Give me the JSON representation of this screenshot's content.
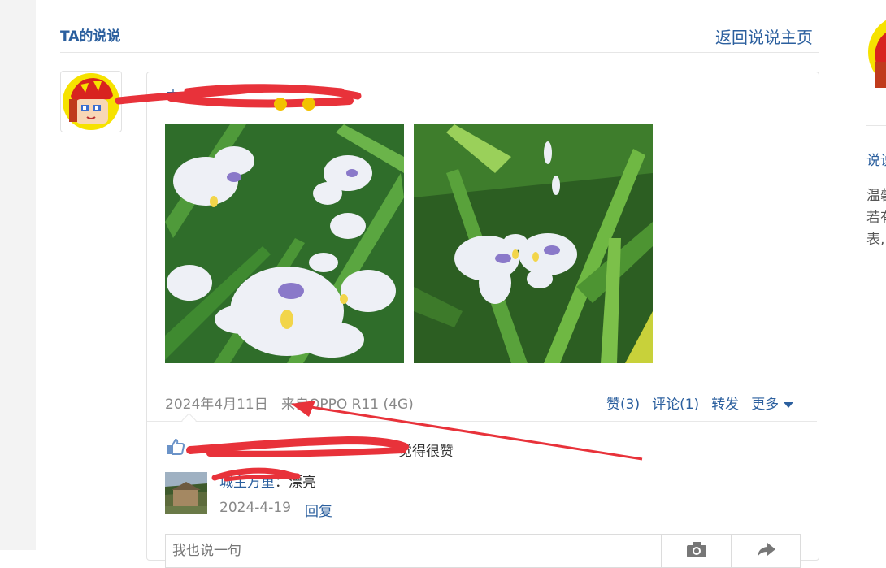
{
  "header": {
    "title": "TA的说说",
    "back_link": "返回说说主页"
  },
  "post": {
    "author": "本",
    "date": "2024年4月11日",
    "source": "来自OPPO R11 (4G)",
    "actions": {
      "like": "赞(3)",
      "comment": "评论(1)",
      "forward": "转发",
      "more": "更多"
    },
    "likes_summary": "觉得很赞",
    "comment": {
      "author": "城主方重",
      "text": "：漂亮",
      "date": "2024-4-19",
      "reply": "回复"
    },
    "reply_placeholder": "我也说一句"
  },
  "sidebar": {
    "label": "说说",
    "lines": [
      "温馨",
      "若有",
      "表,"
    ]
  },
  "colors": {
    "link": "#2b5f9e",
    "muted": "#888888",
    "redaction": "#e8323a"
  },
  "icons": [
    "thumbs-up-icon",
    "camera-icon",
    "share-icon",
    "caret-down-icon"
  ]
}
